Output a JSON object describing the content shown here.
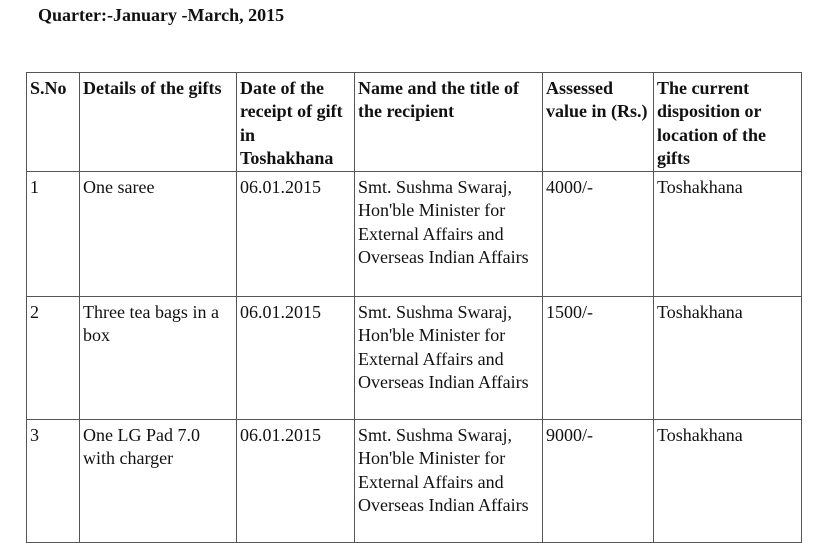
{
  "title": "Quarter:-January -March, 2015",
  "headers": [
    "S.No",
    "Details of the gifts",
    "Date of the receipt of gift in Toshakhana",
    "Name and the title of the recipient",
    "Assessed value in (Rs.)",
    "The current disposition or location of the gifts"
  ],
  "rows": [
    [
      "1",
      "One saree",
      "06.01.2015",
      "Smt. Sushma Swaraj, Hon'ble Minister for External Affairs and Overseas Indian Affairs",
      "4000/-",
      "Toshakhana"
    ],
    [
      "2",
      "Three tea bags in a box",
      "06.01.2015",
      "Smt. Sushma Swaraj, Hon'ble Minister for External Affairs and Overseas Indian Affairs",
      "1500/-",
      "Toshakhana"
    ],
    [
      "3",
      "One LG Pad 7.0 with charger",
      "06.01.2015",
      "Smt. Sushma Swaraj, Hon'ble Minister for External Affairs and Overseas Indian Affairs",
      "9000/-",
      "Toshakhana"
    ]
  ]
}
